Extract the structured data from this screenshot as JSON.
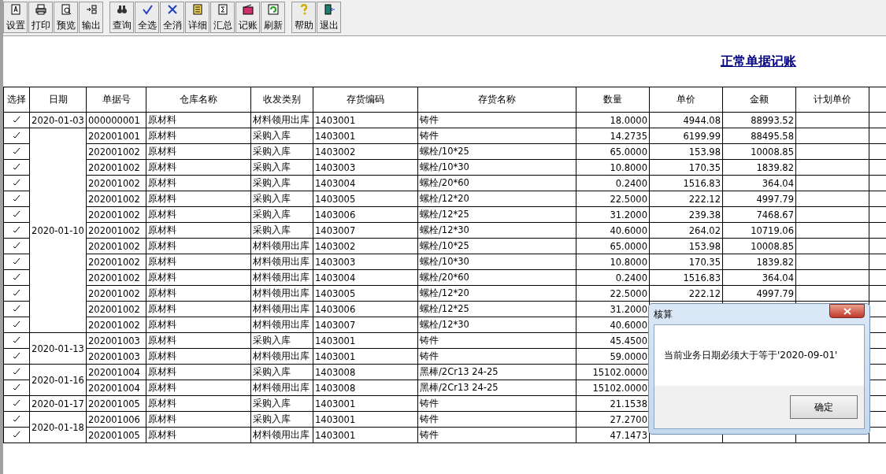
{
  "toolbar": {
    "groups": [
      [
        {
          "label": "设置"
        },
        {
          "label": "打印"
        },
        {
          "label": "预览"
        },
        {
          "label": "输出"
        }
      ],
      [
        {
          "label": "查询"
        },
        {
          "label": "全选"
        },
        {
          "label": "全消"
        },
        {
          "label": "详细"
        },
        {
          "label": "汇总"
        },
        {
          "label": "记账"
        },
        {
          "label": "刷新"
        }
      ],
      [
        {
          "label": "帮助"
        },
        {
          "label": "退出"
        }
      ]
    ]
  },
  "title": "正常单据记账",
  "table": {
    "columns": [
      "选择",
      "日期",
      "单据号",
      "仓库名称",
      "收发类别",
      "存货编码",
      "存货名称",
      "数量",
      "单价",
      "金额",
      "计划单价"
    ],
    "groups": [
      {
        "date": "2020-01-03",
        "rows": [
          {
            "selected": true,
            "doc_no": "000000001",
            "warehouse": "原材料",
            "type": "材料领用出库",
            "code": "1403001",
            "name": "铸件",
            "qty": "18.0000",
            "price": "4944.08",
            "amount": "88993.52"
          }
        ]
      },
      {
        "date": "2020-01-10",
        "rows": [
          {
            "selected": true,
            "doc_no": "202001001",
            "warehouse": "原材料",
            "type": "采购入库",
            "code": "1403001",
            "name": "铸件",
            "qty": "14.2735",
            "price": "6199.99",
            "amount": "88495.58"
          },
          {
            "selected": true,
            "doc_no": "202001002",
            "warehouse": "原材料",
            "type": "采购入库",
            "code": "1403002",
            "name": "螺栓/10*25",
            "qty": "65.0000",
            "price": "153.98",
            "amount": "10008.85"
          },
          {
            "selected": true,
            "doc_no": "202001002",
            "warehouse": "原材料",
            "type": "采购入库",
            "code": "1403003",
            "name": "螺栓/10*30",
            "qty": "10.8000",
            "price": "170.35",
            "amount": "1839.82"
          },
          {
            "selected": true,
            "doc_no": "202001002",
            "warehouse": "原材料",
            "type": "采购入库",
            "code": "1403004",
            "name": "螺栓/20*60",
            "qty": "0.2400",
            "price": "1516.83",
            "amount": "364.04"
          },
          {
            "selected": true,
            "doc_no": "202001002",
            "warehouse": "原材料",
            "type": "采购入库",
            "code": "1403005",
            "name": "螺栓/12*20",
            "qty": "22.5000",
            "price": "222.12",
            "amount": "4997.79"
          },
          {
            "selected": true,
            "doc_no": "202001002",
            "warehouse": "原材料",
            "type": "采购入库",
            "code": "1403006",
            "name": "螺栓/12*25",
            "qty": "31.2000",
            "price": "239.38",
            "amount": "7468.67"
          },
          {
            "selected": true,
            "doc_no": "202001002",
            "warehouse": "原材料",
            "type": "采购入库",
            "code": "1403007",
            "name": "螺栓/12*30",
            "qty": "40.6000",
            "price": "264.02",
            "amount": "10719.06"
          },
          {
            "selected": true,
            "doc_no": "202001002",
            "warehouse": "原材料",
            "type": "材料领用出库",
            "code": "1403002",
            "name": "螺栓/10*25",
            "qty": "65.0000",
            "price": "153.98",
            "amount": "10008.85"
          },
          {
            "selected": true,
            "doc_no": "202001002",
            "warehouse": "原材料",
            "type": "材料领用出库",
            "code": "1403003",
            "name": "螺栓/10*30",
            "qty": "10.8000",
            "price": "170.35",
            "amount": "1839.82"
          },
          {
            "selected": true,
            "doc_no": "202001002",
            "warehouse": "原材料",
            "type": "材料领用出库",
            "code": "1403004",
            "name": "螺栓/20*60",
            "qty": "0.2400",
            "price": "1516.83",
            "amount": "364.04"
          },
          {
            "selected": true,
            "doc_no": "202001002",
            "warehouse": "原材料",
            "type": "材料领用出库",
            "code": "1403005",
            "name": "螺栓/12*20",
            "qty": "22.5000",
            "price": "222.12",
            "amount": "4997.79"
          },
          {
            "selected": true,
            "doc_no": "202001002",
            "warehouse": "原材料",
            "type": "材料领用出库",
            "code": "1403006",
            "name": "螺栓/12*25",
            "qty": "31.2000"
          },
          {
            "selected": true,
            "doc_no": "202001002",
            "warehouse": "原材料",
            "type": "材料领用出库",
            "code": "1403007",
            "name": "螺栓/12*30",
            "qty": "40.6000"
          }
        ]
      },
      {
        "date": "2020-01-13",
        "rows": [
          {
            "selected": true,
            "doc_no": "202001003",
            "warehouse": "原材料",
            "type": "采购入库",
            "code": "1403001",
            "name": "铸件",
            "qty": "45.4500"
          },
          {
            "selected": true,
            "doc_no": "202001003",
            "warehouse": "原材料",
            "type": "材料领用出库",
            "code": "1403001",
            "name": "铸件",
            "qty": "59.0000"
          }
        ]
      },
      {
        "date": "2020-01-16",
        "rows": [
          {
            "selected": true,
            "doc_no": "202001004",
            "warehouse": "原材料",
            "type": "采购入库",
            "code": "1403008",
            "name": "黑棒/2Cr13 24-25",
            "qty": "15102.0000"
          },
          {
            "selected": true,
            "doc_no": "202001004",
            "warehouse": "原材料",
            "type": "材料领用出库",
            "code": "1403008",
            "name": "黑棒/2Cr13 24-25",
            "qty": "15102.0000"
          }
        ]
      },
      {
        "date": "2020-01-17",
        "rows": [
          {
            "selected": true,
            "doc_no": "202001005",
            "warehouse": "原材料",
            "type": "采购入库",
            "code": "1403001",
            "name": "铸件",
            "qty": "21.1538"
          }
        ]
      },
      {
        "date": "2020-01-18",
        "rows": [
          {
            "selected": true,
            "doc_no": "202001006",
            "warehouse": "原材料",
            "type": "采购入库",
            "code": "1403001",
            "name": "铸件",
            "qty": "27.2700"
          },
          {
            "selected": true,
            "doc_no": "202001005",
            "warehouse": "原材料",
            "type": "材料领用出库",
            "code": "1403001",
            "name": "铸件",
            "qty": "47.1473"
          }
        ]
      }
    ]
  },
  "dialog": {
    "title": "核算",
    "message": "当前业务日期必须大于等于'2020-09-01'",
    "button": "确定"
  }
}
